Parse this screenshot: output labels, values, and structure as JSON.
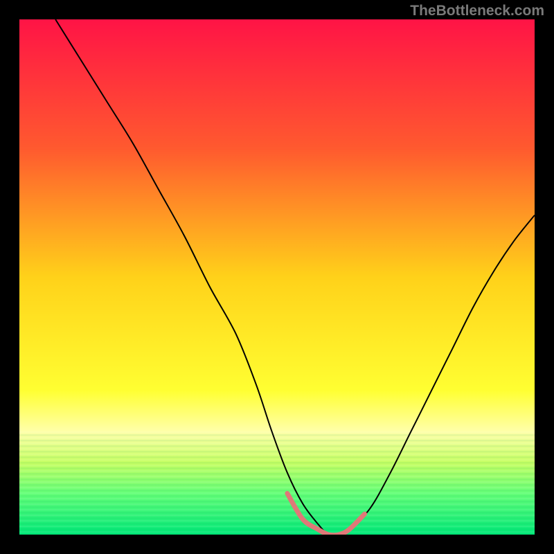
{
  "watermark": "TheBottleneck.com",
  "chart_data": {
    "type": "line",
    "title": "",
    "xlabel": "",
    "ylabel": "",
    "xlim": [
      0,
      100
    ],
    "ylim": [
      0,
      100
    ],
    "gradient_stops": [
      {
        "pct": 0,
        "color": "#ff1446"
      },
      {
        "pct": 25,
        "color": "#ff5a2f"
      },
      {
        "pct": 50,
        "color": "#ffd21a"
      },
      {
        "pct": 72,
        "color": "#ffff32"
      },
      {
        "pct": 80,
        "color": "#ffffaa"
      },
      {
        "pct": 86,
        "color": "#c8ff64"
      },
      {
        "pct": 92,
        "color": "#64ff78"
      },
      {
        "pct": 100,
        "color": "#00e878"
      }
    ],
    "series": [
      {
        "name": "bottleneck-curve",
        "stroke": "#000000",
        "x": [
          7,
          12,
          17,
          22,
          27,
          32,
          37,
          42,
          46,
          49,
          52,
          55,
          58,
          60,
          62,
          64,
          68,
          72,
          76,
          80,
          84,
          88,
          92,
          96,
          100
        ],
        "y": [
          100,
          92,
          84,
          76,
          67,
          58,
          48,
          39,
          29,
          20,
          12,
          6,
          2,
          0,
          0,
          1,
          5,
          12,
          20,
          28,
          36,
          44,
          51,
          57,
          62
        ]
      },
      {
        "name": "optimal-zone-highlight",
        "stroke": "#e07878",
        "stroke_width": 7,
        "x": [
          52,
          55,
          58,
          60,
          62,
          64,
          67
        ],
        "y": [
          8,
          3,
          1,
          0,
          0,
          1,
          4
        ]
      }
    ]
  }
}
